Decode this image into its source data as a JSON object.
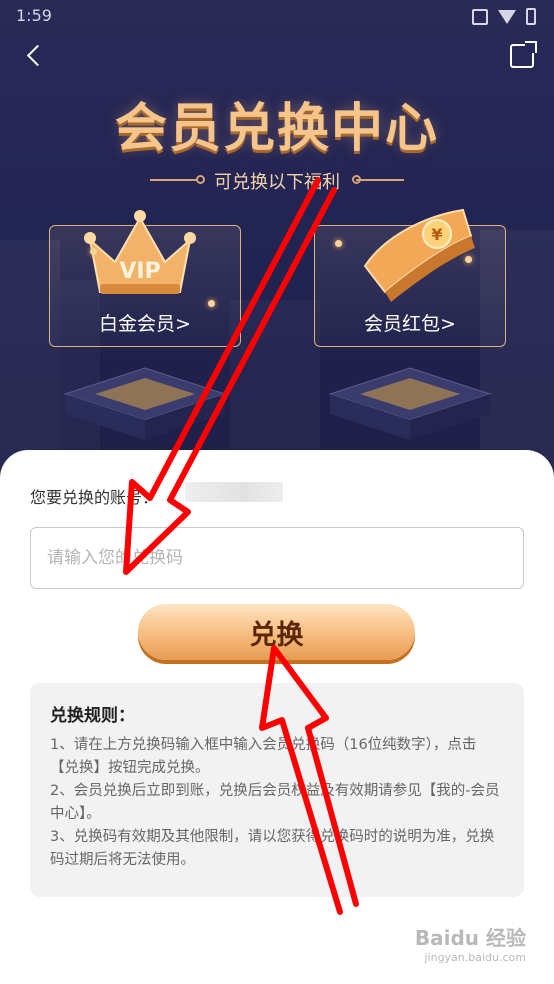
{
  "status": {
    "time": "1:59"
  },
  "header": {
    "title": "会员兑换中心",
    "subtitle": "可兑换以下福利"
  },
  "cards": [
    {
      "label": "白金会员>",
      "badge": "VIP"
    },
    {
      "label": "会员红包>",
      "badge": "¥"
    }
  ],
  "form": {
    "account_label": "您要兑换的账号：",
    "code_placeholder": "请输入您的兑换码",
    "redeem_label": "兑换"
  },
  "rules": {
    "title": "兑换规则：",
    "items": [
      "1、请在上方兑换码输入框中输入会员兑换码（16位纯数字），点击【兑换】按钮完成兑换。",
      "2、会员兑换后立即到账，兑换后会员权益及有效期请参见【我的-会员中心】。",
      "3、兑换码有效期及其他限制，请以您获得兑换码时的说明为准，兑换码过期后将无法使用。"
    ]
  },
  "watermark": {
    "brand": "Baidu 经验",
    "url": "jingyan.baidu.com"
  },
  "colors": {
    "accent": "#f6bd7f",
    "hero_bg": "#222453",
    "annotation": "#ff0000"
  }
}
